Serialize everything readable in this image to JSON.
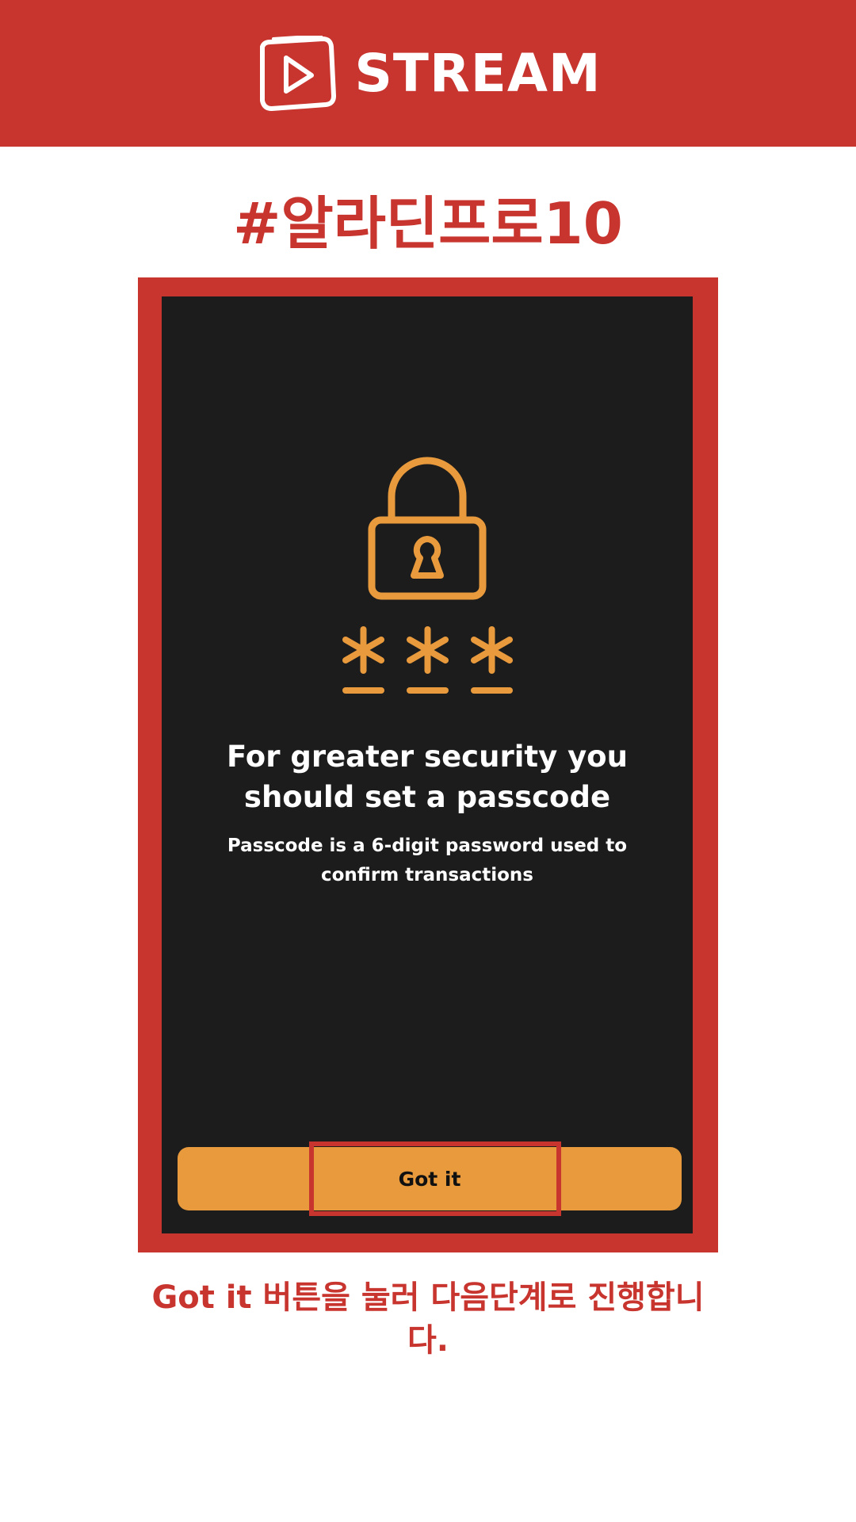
{
  "header": {
    "brand_name": "STREAM",
    "logo_icon": "play-screen-icon",
    "background_color": "#c8342e"
  },
  "hashtag": "#알라딘프로10",
  "screen": {
    "lock_icon": "padlock-icon",
    "passcode_icon": "asterisk-passcode-icon",
    "headline": "For greater security you should set a passcode",
    "subtext": "Passcode is a 6-digit password used to confirm transactions",
    "button_label": "Got it",
    "background_color": "#1c1c1c",
    "accent_color": "#e89a3c"
  },
  "caption": "Got it 버튼을 눌러 다음단계로 진행합니다."
}
